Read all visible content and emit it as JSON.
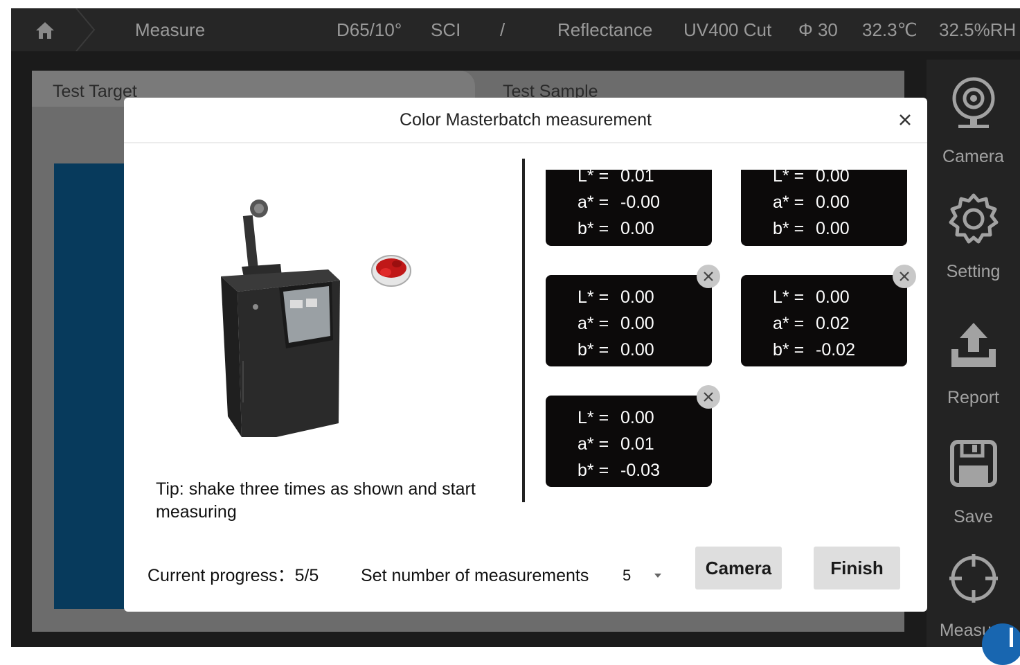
{
  "topbar": {
    "menu": "Measure",
    "illuminant": "D65/10°",
    "mode": "SCI",
    "separator": "/",
    "measurement_type": "Reflectance",
    "uv": "UV400 Cut",
    "aperture": "Φ 30",
    "temperature": "32.3℃",
    "humidity": "32.5%RH"
  },
  "sidebar": {
    "items": [
      {
        "label": "Camera",
        "icon": "camera-icon"
      },
      {
        "label": "Setting",
        "icon": "gear-icon"
      },
      {
        "label": "Report",
        "icon": "upload-icon"
      },
      {
        "label": "Save",
        "icon": "save-icon"
      },
      {
        "label": "Measure",
        "icon": "crosshair-icon"
      }
    ]
  },
  "panel": {
    "tab_target": "Test Target",
    "tab_sample": "Test Sample"
  },
  "dialog": {
    "title": "Color Masterbatch measurement",
    "tip": "Tip: shake three times as shown and start measuring",
    "progress_label": "Current progress：5/5",
    "set_label": "Set number of measurements",
    "set_value": "5",
    "camera_button": "Camera",
    "finish_button": "Finish",
    "results": [
      {
        "L": "0.01",
        "a": "-0.00",
        "b": "0.00"
      },
      {
        "L": "0.00",
        "a": "0.00",
        "b": "0.00"
      },
      {
        "L": "0.00",
        "a": "0.00",
        "b": "0.00"
      },
      {
        "L": "0.00",
        "a": "0.02",
        "b": "-0.02"
      },
      {
        "L": "0.00",
        "a": "0.01",
        "b": "-0.03"
      }
    ],
    "labels": {
      "L": "L* =",
      "a": "a* =",
      "b": "b* ="
    }
  },
  "colors": {
    "accent_blue": "#073a5c",
    "corner_badge": "#1866b0",
    "card_bg": "#0c0a0a"
  }
}
